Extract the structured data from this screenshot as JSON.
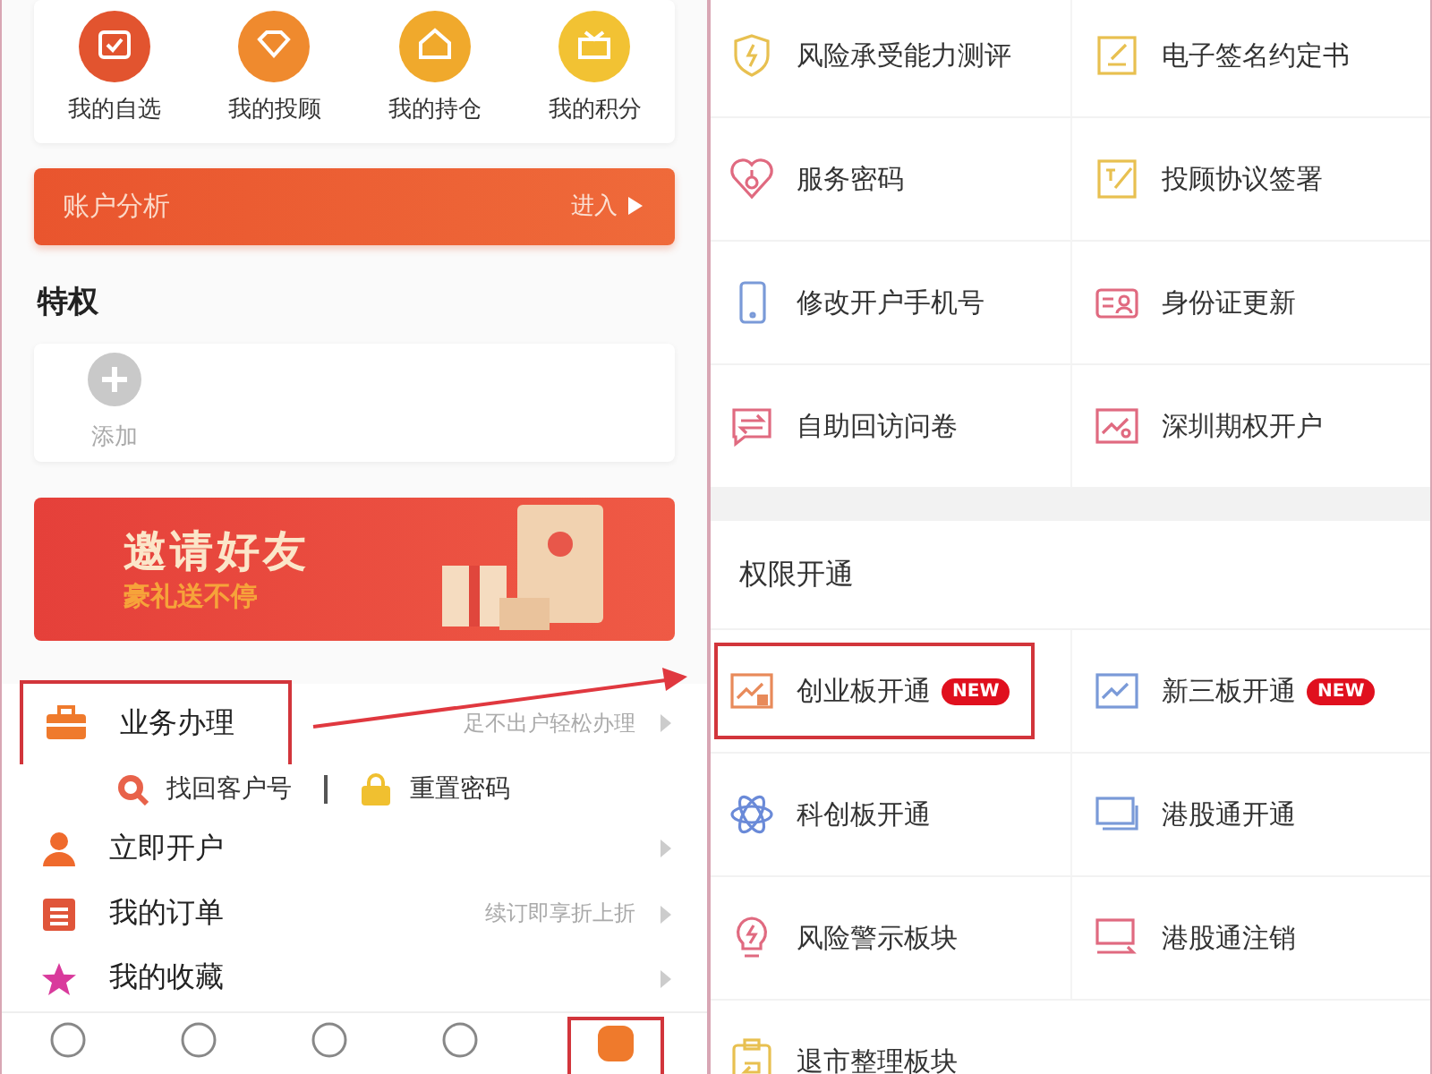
{
  "quick_actions": [
    {
      "label": "我的自选"
    },
    {
      "label": "我的投顾"
    },
    {
      "label": "我的持仓"
    },
    {
      "label": "我的积分"
    }
  ],
  "account_bar": {
    "title": "账户分析",
    "action": "进入"
  },
  "privileges": {
    "title": "特权",
    "add_label": "添加"
  },
  "banner": {
    "title": "邀请好友",
    "subtitle": "豪礼送不停"
  },
  "business_row": {
    "label": "业务办理",
    "hint": "足不出户轻松办理",
    "highlighted": true,
    "links": [
      {
        "label": "找回客户号"
      },
      {
        "label": "重置密码"
      }
    ]
  },
  "menu": [
    {
      "label": "立即开户"
    },
    {
      "label": "我的订单",
      "hint": "续订即享折上折"
    },
    {
      "label": "我的收藏"
    }
  ],
  "tab_bar": [
    {
      "selected": false,
      "highlighted": false
    },
    {
      "selected": false,
      "highlighted": false
    },
    {
      "selected": false,
      "highlighted": false
    },
    {
      "selected": false,
      "highlighted": false
    },
    {
      "selected": true,
      "highlighted": true
    }
  ],
  "services": [
    {
      "label": "风险承受能力测评"
    },
    {
      "label": "电子签名约定书"
    },
    {
      "label": "服务密码"
    },
    {
      "label": "投顾协议签署"
    },
    {
      "label": "修改开户手机号"
    },
    {
      "label": "身份证更新"
    },
    {
      "label": "自助回访问卷"
    },
    {
      "label": "深圳期权开户"
    }
  ],
  "permissions": {
    "title": "权限开通",
    "items": [
      {
        "label": "创业板开通",
        "badge": "NEW",
        "highlighted": true
      },
      {
        "label": "新三板开通",
        "badge": "NEW",
        "highlighted": false
      },
      {
        "label": "科创板开通",
        "highlighted": false
      },
      {
        "label": "港股通开通",
        "highlighted": false
      },
      {
        "label": "风险警示板块",
        "highlighted": false
      },
      {
        "label": "港股通注销",
        "highlighted": false
      },
      {
        "label": "退市整理板块",
        "highlighted": false
      }
    ]
  }
}
